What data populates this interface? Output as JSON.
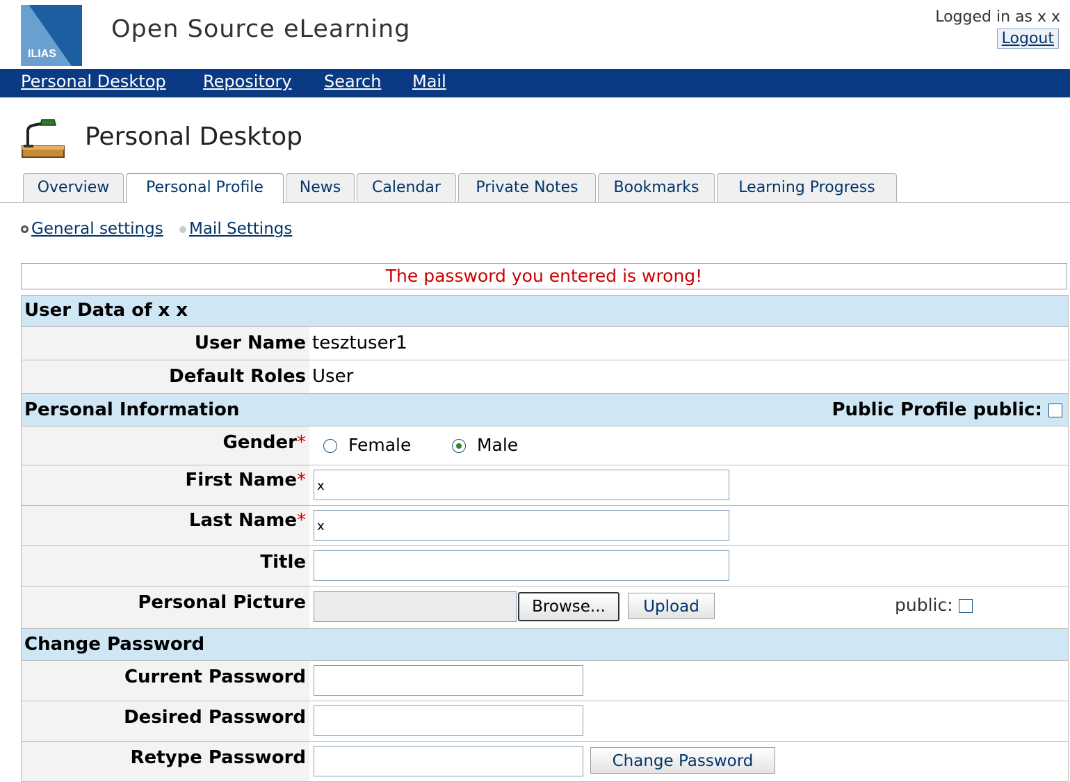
{
  "header": {
    "logo_text": "ILIAS",
    "site_title": "Open Source eLearning",
    "logged_in": "Logged in as x x",
    "logout": "Logout"
  },
  "mainnav": [
    "Personal Desktop",
    "Repository",
    "Search",
    "Mail"
  ],
  "page_title": "Personal Desktop",
  "tabs": [
    "Overview",
    "Personal Profile",
    "News",
    "Calendar",
    "Private Notes",
    "Bookmarks",
    "Learning Progress"
  ],
  "active_tab": "Personal Profile",
  "subtabs": [
    "General settings",
    "Mail Settings"
  ],
  "message": "The password you entered is wrong!",
  "user_data": {
    "header": "User Data of x x",
    "user_name_label": "User Name",
    "user_name": "tesztuser1",
    "roles_label": "Default Roles",
    "roles": "User"
  },
  "personal": {
    "header": "Personal Information",
    "public_profile": "Public Profile public:",
    "gender_label": "Gender",
    "female": "Female",
    "male": "Male",
    "gender_selected": "Male",
    "first_name_label": "First Name",
    "first_name": "x",
    "last_name_label": "Last Name",
    "last_name": "x",
    "title_label": "Title",
    "title": "",
    "picture_label": "Personal Picture",
    "browse": "Browse...",
    "upload": "Upload",
    "picture_public": "public:",
    "required_mark": "*"
  },
  "password": {
    "header": "Change Password",
    "current_label": "Current Password",
    "desired_label": "Desired Password",
    "retype_label": "Retype Password",
    "change_button": "Change Password"
  },
  "colors": {
    "nav_bg": "#0a3a84",
    "section_bg": "#cfe7f5",
    "error": "#cc0000",
    "link": "#03356b"
  }
}
